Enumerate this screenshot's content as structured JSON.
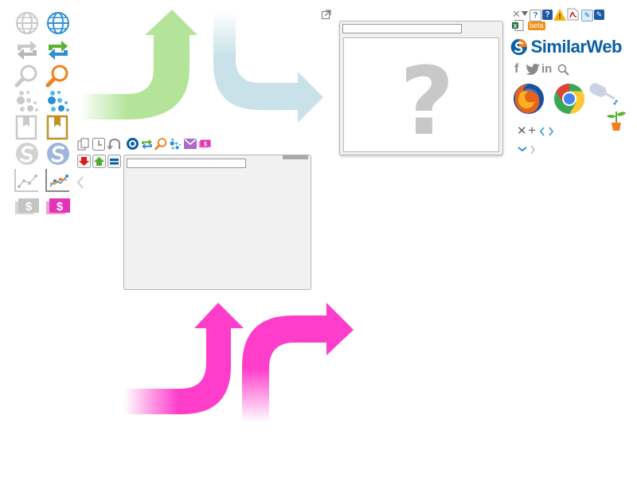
{
  "brand": {
    "name": "SimilarWeb",
    "color": "#0b5fa5"
  },
  "toolbar": {
    "beta_label": "beta"
  },
  "dialog": {
    "placeholder_mark": "?"
  },
  "colors": {
    "green_arrow": "#b4e49a",
    "blue_arrow": "#c9e2e9",
    "pink_arrow": "#ff3dcb",
    "orange": "#f47e1b",
    "green": "#5ab133",
    "blue": "#2f8fd5",
    "gold": "#c09322",
    "magenta": "#e234b7"
  },
  "icon_rows": [
    {
      "name": "globe",
      "gray": "globe-gray-icon",
      "color": "globe-color-icon"
    },
    {
      "name": "arrows",
      "gray": "swap-arrows-gray-icon",
      "color": "swap-arrows-color-icon"
    },
    {
      "name": "search",
      "gray": "search-gray-icon",
      "color": "search-color-icon"
    },
    {
      "name": "bubbles",
      "gray": "bubbles-gray-icon",
      "color": "bubbles-color-icon"
    },
    {
      "name": "bookmark",
      "gray": "bookmark-gray-icon",
      "color": "bookmark-color-icon"
    },
    {
      "name": "similarweb",
      "gray": "similarweb-gray-icon",
      "color": "similarweb-color-icon"
    },
    {
      "name": "chart",
      "gray": "line-chart-gray-icon",
      "color": "line-chart-color-icon"
    },
    {
      "name": "dollar",
      "gray": "dollar-gray-icon",
      "color": "dollar-color-icon"
    }
  ]
}
